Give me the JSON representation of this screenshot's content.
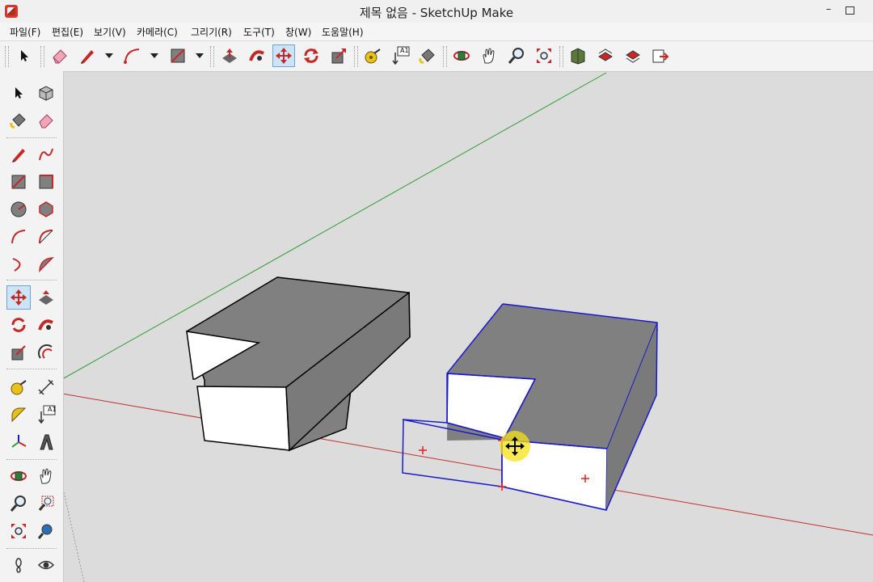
{
  "window": {
    "title": "제목 없음 - SketchUp Make",
    "minimize": "–"
  },
  "menu": [
    "파일(F)",
    "편집(E)",
    "보기(V)",
    "카메라(C)",
    "그리기(R)",
    "도구(T)",
    "창(W)",
    "도움말(H)"
  ],
  "toolbar": {
    "label_tool_text": "A1",
    "active_tool": "move"
  },
  "lefttoolbar": {
    "text_tool_label": "A1",
    "active_tool": "move"
  },
  "colors": {
    "viewport_bg": "#dcdcdc",
    "selection": "#1a1acc",
    "face_top": "#808080",
    "face_side_light": "#ffffff",
    "face_side_dark": "#7a7a7a",
    "axis_red": "#c0302a",
    "axis_green": "#2f9e2f",
    "cursor_highlight": "#f5e21a"
  }
}
